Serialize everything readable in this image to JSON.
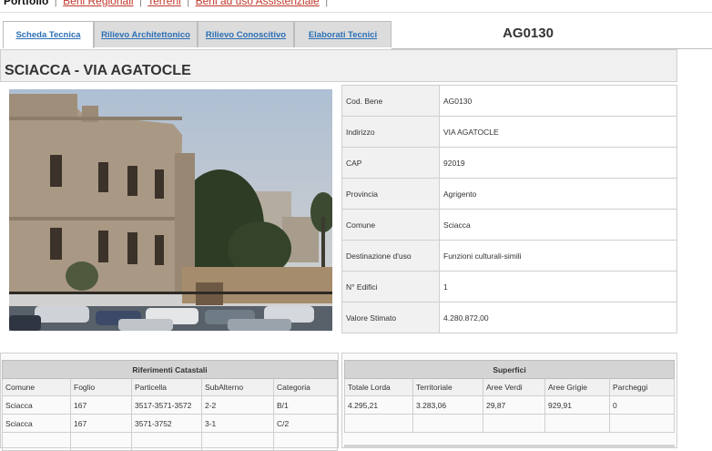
{
  "nav": {
    "current": "Portfolio",
    "links": [
      "Beni Regionali",
      "Terreni",
      "Beni ad uso Assistenziale"
    ],
    "separator": "|"
  },
  "tabs": [
    {
      "label": "Scheda Tecnica",
      "active": true
    },
    {
      "label": "Rilievo Architettonico",
      "active": false
    },
    {
      "label": "Rilievo Conoscitivo",
      "active": false
    },
    {
      "label": "Elaborati Tecnici",
      "active": false
    }
  ],
  "asset_code": "AG0130",
  "title": "SCIACCA - VIA AGATOCLE",
  "details": [
    {
      "label": "Cod. Bene",
      "value": "AG0130"
    },
    {
      "label": "Indirizzo",
      "value": "VIA AGATOCLE"
    },
    {
      "label": "CAP",
      "value": "92019"
    },
    {
      "label": "Provincia",
      "value": "Agrigento"
    },
    {
      "label": "Comune",
      "value": "Sciacca"
    },
    {
      "label": "Destinazione d'uso",
      "value": "Funzioni culturali-simili"
    },
    {
      "label": "N° Edifici",
      "value": "1"
    },
    {
      "label": "Valore Stimato",
      "value": "4.280.872,00"
    }
  ],
  "catastali": {
    "caption": "Riferimenti Catastali",
    "columns": [
      "Comune",
      "Foglio",
      "Particella",
      "SubAlterno",
      "Categoria"
    ],
    "rows": [
      [
        "Sciacca",
        "167",
        "3517-3571-3572",
        "2-2",
        "B/1"
      ],
      [
        "Sciacca",
        "167",
        "3571-3752",
        "3-1",
        "C/2"
      ]
    ]
  },
  "superfici": {
    "caption": "Superfici",
    "columns": [
      "Totale Lorda",
      "Territoriale",
      "Aree Verdi",
      "Aree Grigie",
      "Parcheggi"
    ],
    "rows": [
      [
        "4.295,21",
        "3.283,06",
        "29,87",
        "929,91",
        "0"
      ]
    ]
  }
}
